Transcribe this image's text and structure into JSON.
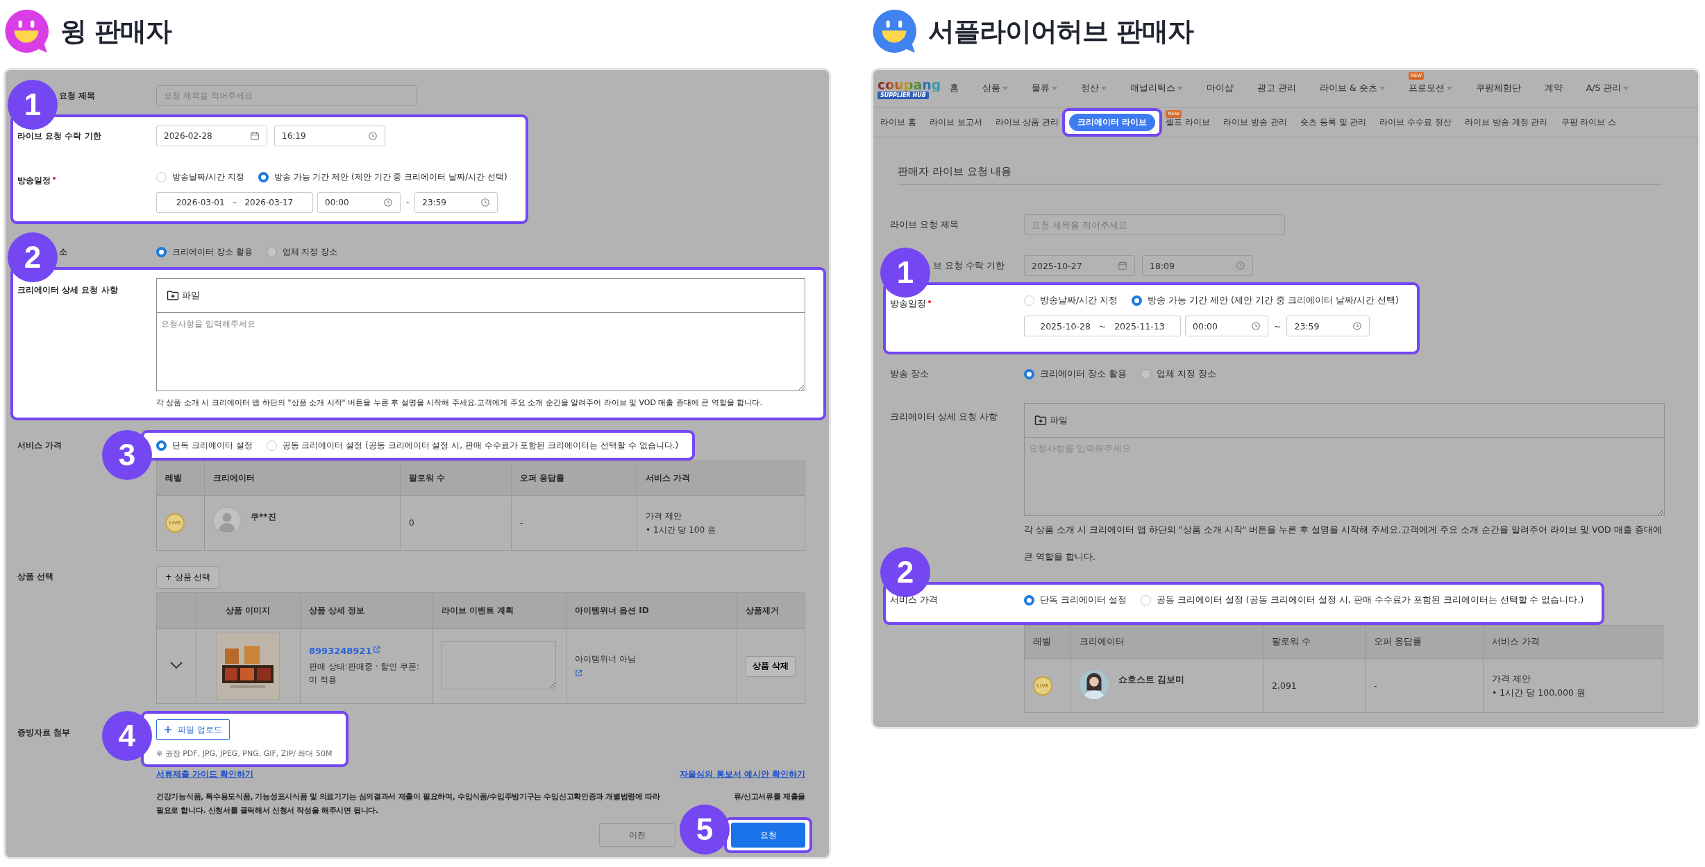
{
  "panels": [
    {
      "kind": "wing",
      "title": "윙 판매자",
      "color": "#d93ee6",
      "rows": [
        {
          "kind": "field",
          "label": "요청 제목",
          "label_covered": true,
          "placeholder": "요청 제목을 적어주세요"
        },
        {
          "kind": "callout",
          "number": "1",
          "rows": [
            {
              "kind": "deadline",
              "label": "라이브 요청 수락 기한",
              "date": "2026-02-28",
              "time": "16:19"
            },
            {
              "kind": "schedule",
              "label": "방송일정",
              "required": true,
              "options": [
                {
                  "label": "방송날짜/시간 지정",
                  "selected": false
                },
                {
                  "label": "방송 가능 기간 제안 (제안 기간 중 크리에이터 날짜/시간 선택)",
                  "selected": true
                }
              ],
              "start_date": "2026-03-01",
              "date_separator": "–",
              "end_date": "2026-03-17",
              "start_time": "00:00",
              "time_separator": "-",
              "end_time": "23:59"
            }
          ]
        },
        {
          "kind": "radio",
          "label": "소",
          "label_covered": true,
          "options": [
            {
              "label": "크리에이터 장소 활용",
              "selected": true
            },
            {
              "label": "업체 지정 장소",
              "selected": false
            }
          ]
        },
        {
          "kind": "callout",
          "number": "2",
          "rows": [
            {
              "kind": "editor",
              "label": "크리에이터 상세 요청 사항",
              "file_button": "파일",
              "placeholder": "요청사항을 입력해주세요",
              "hint": "각 상품 소개 시 크리에이터 앱 하단의 \"상품 소개 시작\" 버튼을 누른 후 설명을 시작해 주세요.고객에게 주요 소개 순간을 알려주어 라이브 및 VOD 매출 증대에 큰 역할을 합니다."
            }
          ]
        },
        {
          "kind": "radio",
          "label": "서비스 가격",
          "callout": "3",
          "options": [
            {
              "label": "단독 크리에이터 설정",
              "selected": true
            },
            {
              "label": "공동 크리에이터 설정 (공동 크리에이터 설정 시, 판매 수수료가 포함된 크리에이터는 선택할 수 없습니다.)",
              "selected": false
            }
          ]
        },
        {
          "kind": "creator_table",
          "columns": [
            "레벨",
            "크리에이터",
            "팔로워 수",
            "오퍼 응답률",
            "서비스 가격"
          ],
          "rows": [
            {
              "kind": "silhouette",
              "level": "LIVE",
              "name": "쿠**진",
              "followers": "0",
              "response_rate": "-",
              "price_title": "가격 제안",
              "price": "• 1시간 당 100 원"
            }
          ]
        },
        {
          "kind": "button",
          "label": "상품 선택",
          "button": "+ 상품 선택"
        },
        {
          "kind": "product_table",
          "columns": [
            "상품 이미지",
            "상품 상세 정보",
            "라이브 이벤트 계획",
            "아이템위너 옵션 ID",
            "상품제거"
          ],
          "rows": [
            {
              "product_id": "8993248921",
              "status": "판매 상태:판매중 · 할인 쿠폰: 미 적용",
              "winner": "아이템위너 아님",
              "remove": "상품 삭제"
            }
          ]
        },
        {
          "kind": "upload",
          "label": "증빙자료 첨부",
          "callout": "4",
          "button": "파일 업로드",
          "hint": "※ 권장 PDF, JPG, JPEG, PNG, GIF, ZIP/ 최대 50M"
        },
        {
          "kind": "links",
          "links": [
            "서류제출 가이드 확인하기",
            "자율심의 통보서 예시안 확인하기"
          ]
        },
        {
          "kind": "paragraph",
          "lines": [
            [
              "건강기능식품, 특수용도식품, 기능성표시식품 및 의료기기는 심의결과서 제출이 필요하며, 수입식품/수입주방기구는 수입신고확인증과 개별법령에 따라",
              "류/신고서류를 제출을"
            ],
            [
              "필요로 합니다. 신청서를 클릭해서 신청서 작성을 해주시면 됩니다."
            ]
          ]
        },
        {
          "kind": "actions",
          "buttons": [
            {
              "label": "이전",
              "primary": false
            },
            {
              "label": "요청",
              "primary": true,
              "callout": "5"
            }
          ]
        }
      ]
    },
    {
      "kind": "hub",
      "title": "서플라이어허브 판매자",
      "color": "#3f82f0",
      "nav": {
        "logo": "coupang",
        "logo_tag": "SUPPLIER HUB",
        "menu": [
          {
            "label": "홈",
            "dropdown": false
          },
          {
            "label": "상품",
            "dropdown": true
          },
          {
            "label": "물류",
            "dropdown": true
          },
          {
            "label": "정산",
            "dropdown": true
          },
          {
            "label": "애널리틱스",
            "dropdown": true
          },
          {
            "label": "마이샵",
            "dropdown": false
          },
          {
            "label": "광고 관리",
            "dropdown": false
          },
          {
            "label": "라이브 & 숏츠",
            "dropdown": true
          },
          {
            "label": "프로모션",
            "dropdown": true,
            "badge": "NEW"
          },
          {
            "label": "쿠팡체험단",
            "dropdown": false
          },
          {
            "label": "계약",
            "dropdown": false
          },
          {
            "label": "A/S 관리",
            "dropdown": true
          }
        ],
        "submenu": [
          {
            "label": "라이브 홈",
            "selected": false,
            "highlighted": false
          },
          {
            "label": "라이브 보고서",
            "selected": false,
            "highlighted": false
          },
          {
            "label": "라이브 상품 관리",
            "selected": false,
            "highlighted": false
          },
          {
            "label": "크리에이터 라이브",
            "selected": true,
            "highlighted": true
          },
          {
            "label": "셀프 라이브",
            "selected": false,
            "highlighted": false,
            "badge": "NEW"
          },
          {
            "label": "라이브 방송 관리",
            "selected": false,
            "highlighted": false
          },
          {
            "label": "숏츠 등록 및 관리",
            "selected": false,
            "highlighted": false
          },
          {
            "label": "라이브 수수료 정산",
            "selected": false,
            "highlighted": false
          },
          {
            "label": "라이브 방송 계정 관리",
            "selected": false,
            "highlighted": false
          },
          {
            "label": "쿠팡 라이브 스",
            "selected": false,
            "highlighted": false
          }
        ]
      },
      "section_title": "판매자 라이브 요청 내용",
      "rows": [
        {
          "kind": "field",
          "label": "라이브 요청 제목",
          "placeholder": "요청 제목을 적어주세요"
        },
        {
          "kind": "deadline",
          "label": "브 요청 수락 기한",
          "label_covered": true,
          "date": "2025-10-27",
          "time": "18:09"
        },
        {
          "kind": "callout",
          "number": "1",
          "rows": [
            {
              "kind": "schedule",
              "label": "방송일정",
              "required": true,
              "options": [
                {
                  "label": "방송날짜/시간 지정",
                  "selected": false
                },
                {
                  "label": "방송 가능 기간 제안 (제안 기간 중 크리에이터 날짜/시간 선택)",
                  "selected": true
                }
              ],
              "start_date": "2025-10-28",
              "date_separator": "~",
              "end_date": "2025-11-13",
              "start_time": "00:00",
              "time_separator": "~",
              "end_time": "23:59"
            }
          ]
        },
        {
          "kind": "radio",
          "label": "방송 장소",
          "options": [
            {
              "label": "크리에이터 장소 활용",
              "selected": true
            },
            {
              "label": "업체 지정 장소",
              "selected": false
            }
          ]
        },
        {
          "kind": "editor",
          "label": "크리에이터 상세 요청 사항",
          "file_button": "파일",
          "placeholder": "요청사항을 입력해주세요",
          "hint": "각 상품 소개 시 크리에이터 앱 하단의 \"상품 소개 시작\" 버튼을 누른 후 설명을 시작해 주세요.고객에게 주요 소개 순간을 알려주어 라이브 및 VOD 매출 증대에 큰 역할을 합니다."
        },
        {
          "kind": "callout",
          "number": "2",
          "rows": [
            {
              "kind": "radio",
              "label": "서비스 가격",
              "options": [
                {
                  "label": "단독 크리에이터 설정",
                  "selected": true
                },
                {
                  "label": "공동 크리에이터 설정 (공동 크리에이터 설정 시, 판매 수수료가 포함된 크리에이터는 선택할 수 없습니다.)",
                  "selected": false
                }
              ]
            }
          ]
        },
        {
          "kind": "creator_table",
          "columns": [
            "레벨",
            "크리에이터",
            "팔로워 수",
            "오퍼 응답률",
            "서비스 가격"
          ],
          "rows": [
            {
              "level": "LIVE",
              "name": "쇼호스트 김보미",
              "followers": "2,091",
              "response_rate": "-",
              "price_title": "가격 제안",
              "price": "• 1시간 당 100,000 원"
            }
          ]
        }
      ]
    }
  ]
}
